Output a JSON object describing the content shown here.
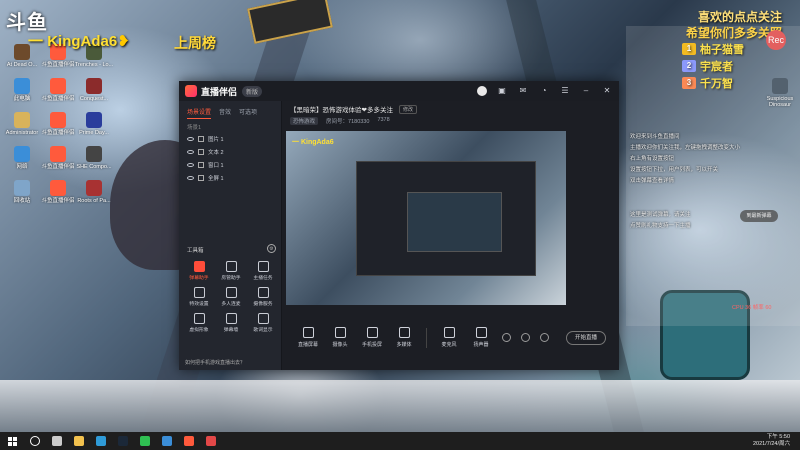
{
  "overlay": {
    "logo": "斗鱼",
    "streamer_prefix": "一",
    "streamer_name": "KingAda6",
    "streamer_heart": "❥",
    "top_ranking": "上周榜",
    "follow_line_1": "喜欢的点点关注",
    "follow_line_2": "希望你们多多关照",
    "rec_badge": "Rec",
    "viewers": [
      {
        "rank": "1",
        "name": "柚子猫雪",
        "color": "#f5b400"
      },
      {
        "rank": "2",
        "name": "宇宸者",
        "color": "#7c8cff"
      },
      {
        "rank": "3",
        "name": "千万智",
        "color": "#ff7a3d"
      }
    ]
  },
  "desktop_icons": [
    {
      "label": "At Dead O...",
      "color": "#6d4a2b"
    },
    {
      "label": "斗鱼直播伴侣",
      "color": "#ff5a3c"
    },
    {
      "label": "Trenches - Lo...",
      "color": "#4a5a3a"
    },
    {
      "label": "此电脑",
      "color": "#3b8ed8"
    },
    {
      "label": "斗鱼直播伴侣",
      "color": "#ff5a3c"
    },
    {
      "label": "Conquest...",
      "color": "#8b2b2b"
    },
    {
      "label": "Administrator",
      "color": "#d9b35b"
    },
    {
      "label": "斗鱼直播伴侣",
      "color": "#ff5a3c"
    },
    {
      "label": "Prime Day...",
      "color": "#2a3d9c"
    },
    {
      "label": "网络",
      "color": "#3b8ed8"
    },
    {
      "label": "斗鱼直播伴侣",
      "color": "#ff5a3c"
    },
    {
      "label": "SHE Compo...",
      "color": "#444"
    },
    {
      "label": "回收站",
      "color": "#7fa5c9"
    },
    {
      "label": "斗鱼直播伴侣",
      "color": "#ff5a3c"
    },
    {
      "label": "Roots of Pa...",
      "color": "#a83232"
    }
  ],
  "right_desktop_icon": "Suspicious Dinosaur",
  "app": {
    "name": "直播伴侣",
    "version": "新版",
    "tabs": [
      "场景设置",
      "音效",
      "可选项"
    ],
    "scene_label": "场景1",
    "sources": [
      {
        "name": "图片 1"
      },
      {
        "name": "文本 2"
      },
      {
        "name": "窗口 1"
      },
      {
        "name": "全屏 1"
      }
    ],
    "tools_title": "工具箱",
    "tools": [
      {
        "label": "弹幕助手",
        "hot": true
      },
      {
        "label": "房管助手",
        "hot": false
      },
      {
        "label": "主播任务",
        "hot": false
      },
      {
        "label": "特效设置",
        "hot": false
      },
      {
        "label": "多人连麦",
        "hot": false
      },
      {
        "label": "摄像服务",
        "hot": false
      },
      {
        "label": "虚拟形象",
        "hot": false
      },
      {
        "label": "弹幕墙",
        "hot": false
      },
      {
        "label": "歌词显示",
        "hot": false
      }
    ],
    "left_footer": "如何把手机游戏直播出去？",
    "room": {
      "title": "【黑暗荣】恐怖游戏体验❤多多关注",
      "edit_label": "修改",
      "category": "恐怖游戏",
      "room_no": "房间号：7180330",
      "fans": "7378"
    },
    "preview_id": "一 KingAda6",
    "bottom_items": [
      "直播屏幕",
      "摄像头",
      "手机投屏",
      "多媒体",
      "麦克风",
      "扬声器"
    ],
    "start_label": "开始直播"
  },
  "chat": {
    "lines": [
      "欢迎来到斗鱼直播间",
      "主播欢迎你们关注我，左键拖拽调整改变大小",
      "右上角有设置按钮",
      "设置按钮下拉，用户列表，可以开关",
      "双击弹幕查看详情",
      "这里是测试弹幕，请关注",
      "点赞刷礼物支持一下主播"
    ],
    "scroll_btn": "到最新弹幕",
    "live_counter": "CPU 36  帧率 60"
  },
  "taskbar": {
    "apps": [
      {
        "name": "search-app",
        "color": "#ffffff"
      },
      {
        "name": "task-view",
        "color": "#cccccc"
      },
      {
        "name": "file-explorer",
        "color": "#f2c14e"
      },
      {
        "name": "edge-browser",
        "color": "#2f9bd8"
      },
      {
        "name": "steam",
        "color": "#1b2838"
      },
      {
        "name": "wechat",
        "color": "#2fbf52"
      },
      {
        "name": "qq",
        "color": "#3b8ed8"
      },
      {
        "name": "douyu-companion",
        "color": "#ff5a3c"
      },
      {
        "name": "recorder",
        "color": "#e34848"
      }
    ],
    "time": "下午 5:50",
    "date": "2021/7/24/周六"
  }
}
